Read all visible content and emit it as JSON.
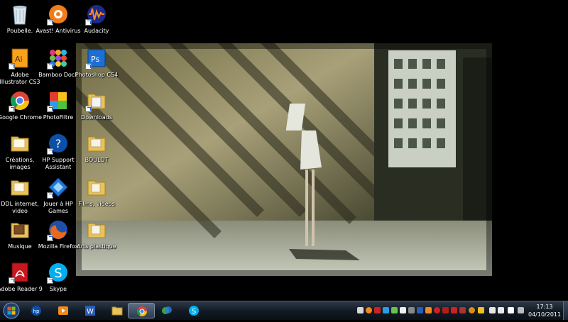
{
  "desktop": {
    "icons": [
      {
        "label": "Poubelle.",
        "icon": "recycle-bin-icon"
      },
      {
        "label": "Avast! Antivirus",
        "icon": "avast-icon"
      },
      {
        "label": "Audacity",
        "icon": "audacity-icon"
      },
      {
        "label": "Adobe Illustrator CS3",
        "icon": "illustrator-icon"
      },
      {
        "label": "Bamboo Dock",
        "icon": "bamboo-dock-icon"
      },
      {
        "label": "Photoshop CS4",
        "icon": "photoshop-icon"
      },
      {
        "label": "Google Chrome",
        "icon": "chrome-icon"
      },
      {
        "label": "PhotoFiltre",
        "icon": "photofiltre-icon"
      },
      {
        "label": "Downloads",
        "icon": "folder-icon"
      },
      {
        "label": "Créations, images",
        "icon": "folder-icon"
      },
      {
        "label": "HP Support Assistant",
        "icon": "hp-support-icon"
      },
      {
        "label": "BOULOT",
        "icon": "folder-icon"
      },
      {
        "label": "DDL internet, video",
        "icon": "folder-icon"
      },
      {
        "label": "Jouer à HP Games",
        "icon": "hp-games-icon"
      },
      {
        "label": "Films, videos",
        "icon": "folder-icon"
      },
      {
        "label": "Musique",
        "icon": "folder-icon"
      },
      {
        "label": "Mozilla Firefox",
        "icon": "firefox-icon"
      },
      {
        "label": "Arts plastique",
        "icon": "folder-icon"
      },
      {
        "label": "Adobe Reader 9",
        "icon": "adobe-reader-icon"
      },
      {
        "label": "Skype",
        "icon": "skype-icon"
      }
    ]
  },
  "taskbar": {
    "start": "windows-start-orb-icon",
    "pinned": [
      {
        "icon": "hp-icon"
      },
      {
        "icon": "media-player-icon"
      },
      {
        "icon": "word-icon"
      },
      {
        "icon": "explorer-folder-icon"
      },
      {
        "icon": "chrome-icon",
        "active": true
      },
      {
        "icon": "windows-live-icon"
      },
      {
        "icon": "skype-icon"
      }
    ],
    "clock": {
      "time": "17:13",
      "date": "04/10/2011"
    }
  },
  "colors": {
    "taskbar": "#111922",
    "folder": "#e8c25a",
    "desktop_bg": "#000000"
  }
}
